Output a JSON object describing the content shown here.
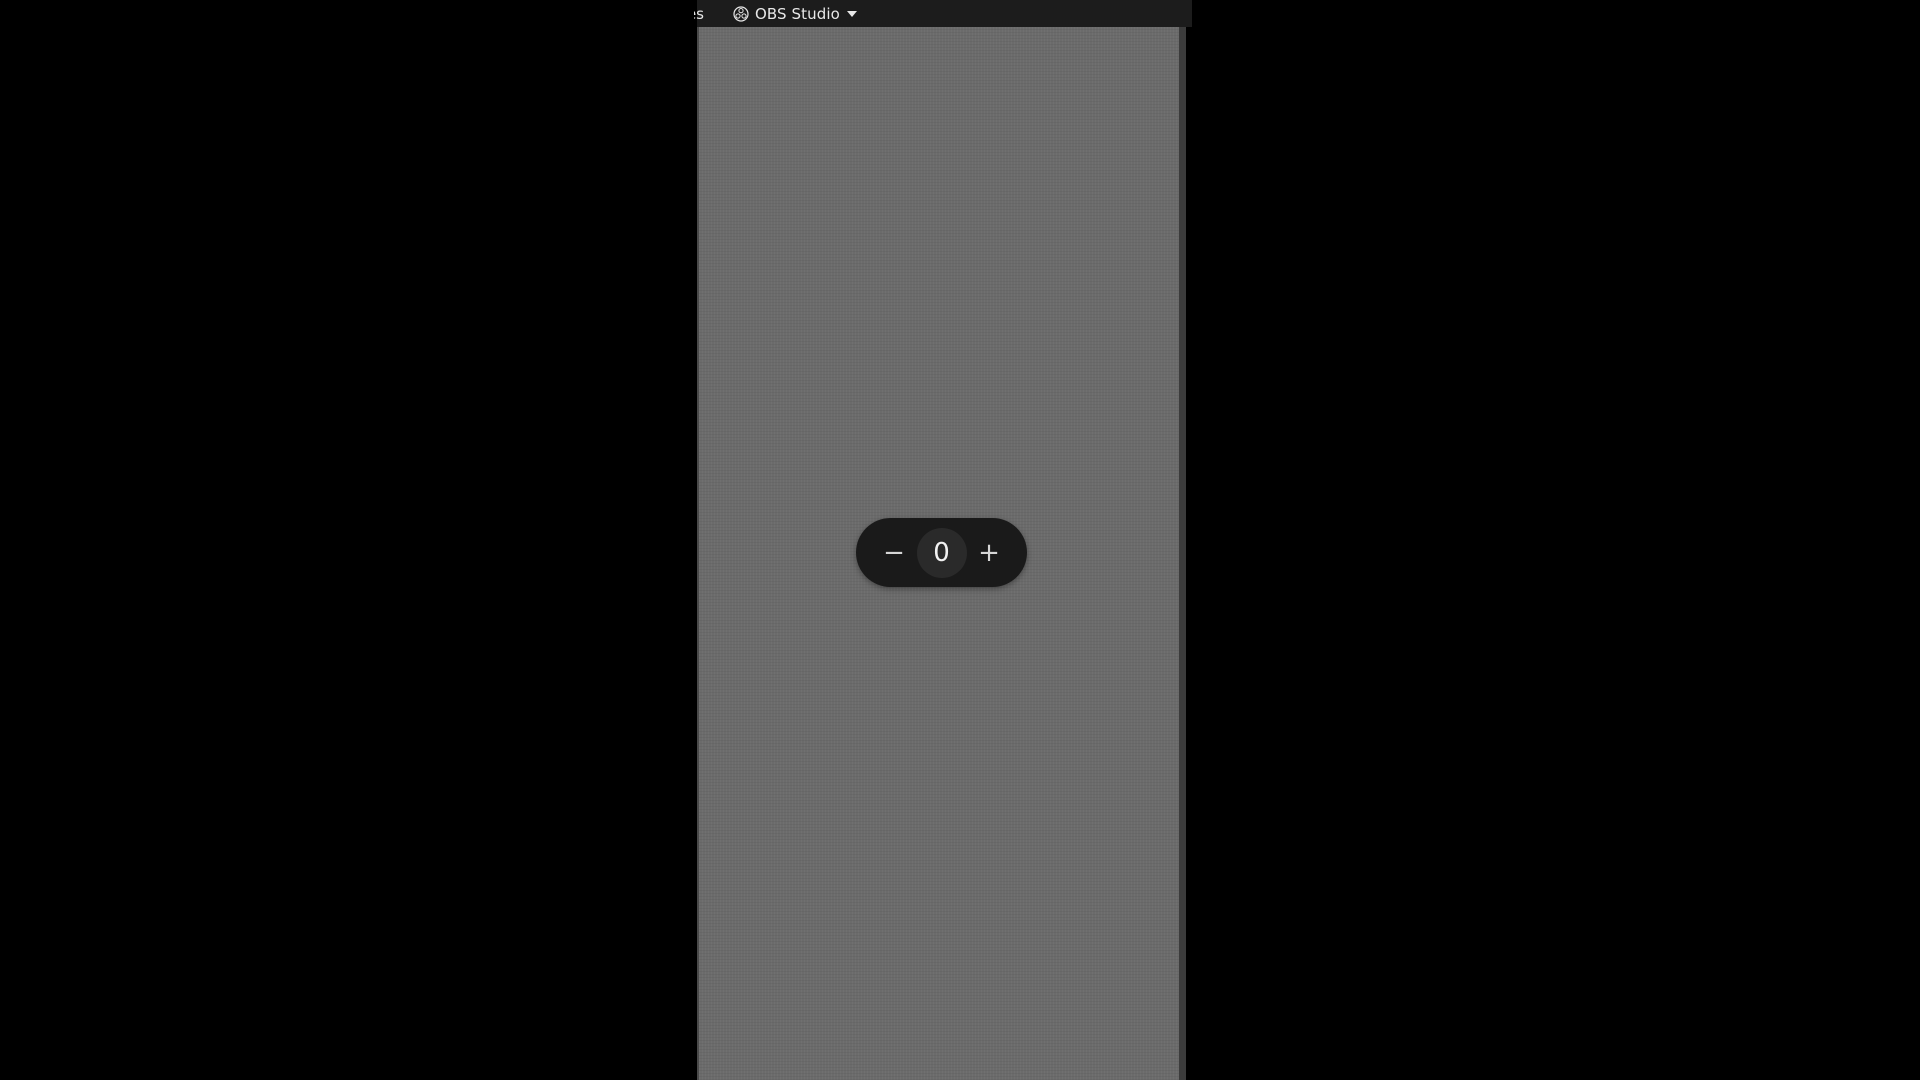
{
  "topbar": {
    "activities_label": "Activities",
    "app_name": "OBS Studio",
    "app_icon": "obs-icon",
    "menu_icon": "chevron-down-icon"
  },
  "stepper": {
    "decrement_label": "−",
    "value": "0",
    "increment_label": "+",
    "decrement_icon": "minus-icon",
    "increment_icon": "plus-icon"
  },
  "colors": {
    "desktop_bg": "#000000",
    "topbar_bg": "#1c1c1c",
    "preview_bg": "#6b6b6b",
    "stepper_bg": "#1a1a1a",
    "value_bg": "#2a2a2a",
    "text": "#e8e8e8"
  }
}
